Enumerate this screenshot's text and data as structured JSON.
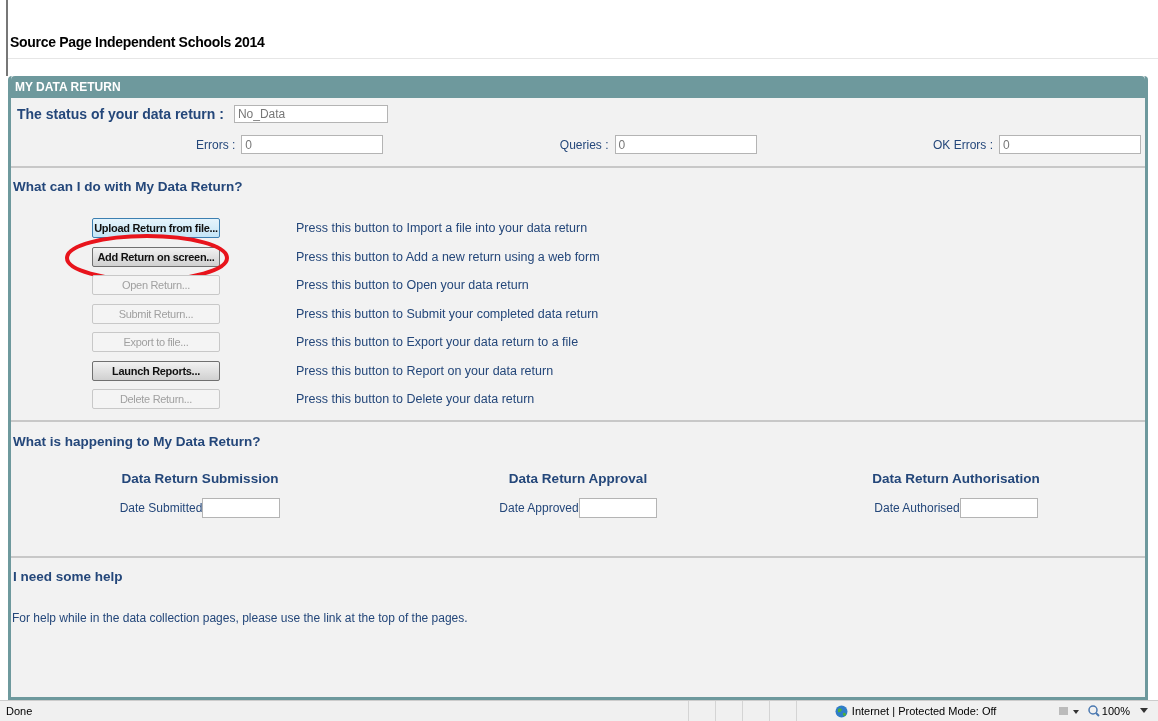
{
  "page_title": "Source Page Independent Schools 2014",
  "panel": {
    "title": "MY DATA RETURN",
    "status": {
      "label": "The status of your data return :",
      "value": "No_Data"
    },
    "counts": [
      {
        "label": "Errors :",
        "value": "0"
      },
      {
        "label": "Queries :",
        "value": "0"
      },
      {
        "label": "OK Errors :",
        "value": "0"
      }
    ],
    "actions_heading": "What can I do with My Data Return?",
    "actions": [
      {
        "button": "Upload Return from file...",
        "disabled": false,
        "focused": true,
        "circled": false,
        "description": "Press this button to Import a file into your data return"
      },
      {
        "button": "Add Return on screen...",
        "disabled": false,
        "focused": false,
        "circled": true,
        "description": "Press this button to Add a new return using a web form"
      },
      {
        "button": "Open Return...",
        "disabled": true,
        "focused": false,
        "circled": false,
        "description": "Press this button to Open your data return"
      },
      {
        "button": "Submit Return...",
        "disabled": true,
        "focused": false,
        "circled": false,
        "description": "Press this button to Submit your completed data return"
      },
      {
        "button": "Export to file...",
        "disabled": true,
        "focused": false,
        "circled": false,
        "description": "Press this button to Export your data return to a file"
      },
      {
        "button": "Launch Reports...",
        "disabled": false,
        "focused": false,
        "circled": false,
        "description": "Press this button to Report on your data return"
      },
      {
        "button": "Delete Return...",
        "disabled": true,
        "focused": false,
        "circled": false,
        "description": "Press this button to Delete your data return"
      }
    ],
    "progress_heading": "What is happening to My Data Return?",
    "stages": [
      {
        "heading": "Data Return Submission",
        "label": "Date Submitted"
      },
      {
        "heading": "Data Return Approval",
        "label": "Date Approved"
      },
      {
        "heading": "Data Return Authorisation",
        "label": "Date Authorised"
      }
    ],
    "help_heading": "I need some help",
    "help_text": "For help while in the data collection pages, please use the link at the top of the pages."
  },
  "status_bar": {
    "left": "Done",
    "zone": "Internet | Protected Mode: Off",
    "zoom": "100%"
  }
}
